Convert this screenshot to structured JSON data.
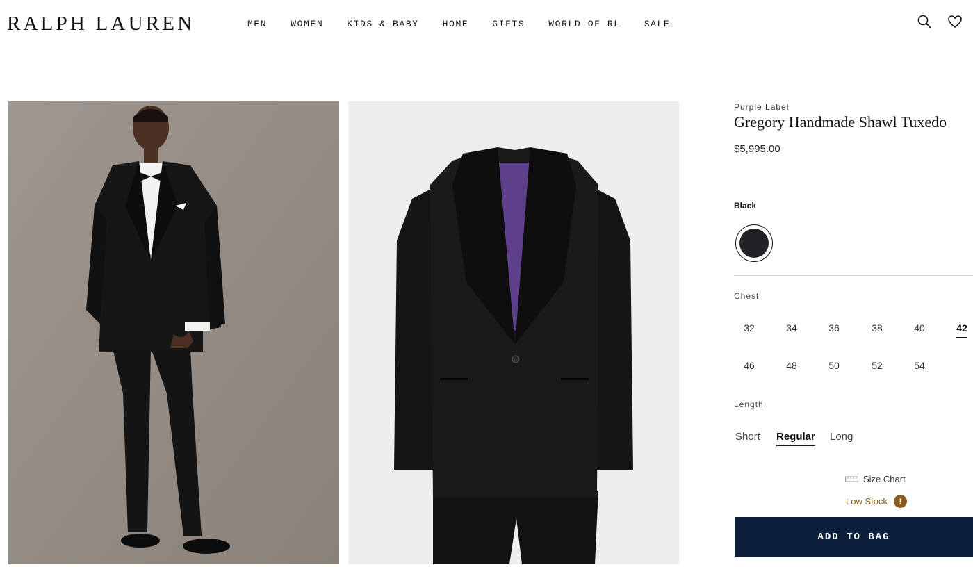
{
  "header": {
    "logo": "RALPH LAUREN",
    "nav": [
      "MEN",
      "WOMEN",
      "KIDS & BABY",
      "HOME",
      "GIFTS",
      "WORLD OF RL",
      "SALE"
    ],
    "icons": [
      "search-icon",
      "heart-icon"
    ]
  },
  "product": {
    "brand": "Purple Label",
    "title": "Gregory Handmade Shawl Tuxedo",
    "price": "$5,995.00",
    "color": {
      "name": "Black",
      "swatch": "#222226"
    },
    "chest_label": "Chest",
    "chest_sizes": [
      "32",
      "34",
      "36",
      "38",
      "40",
      "42",
      "46",
      "48",
      "50",
      "52",
      "54"
    ],
    "chest_selected": "42",
    "length_label": "Length",
    "lengths": [
      "Short",
      "Regular",
      "Long"
    ],
    "length_selected": "Regular",
    "size_chart": "Size Chart",
    "stock_status": "Low Stock",
    "add_to_bag": "ADD TO BAG"
  },
  "colors": {
    "button_bg": "#0a1f3a",
    "stock": "#8a5b1c"
  }
}
